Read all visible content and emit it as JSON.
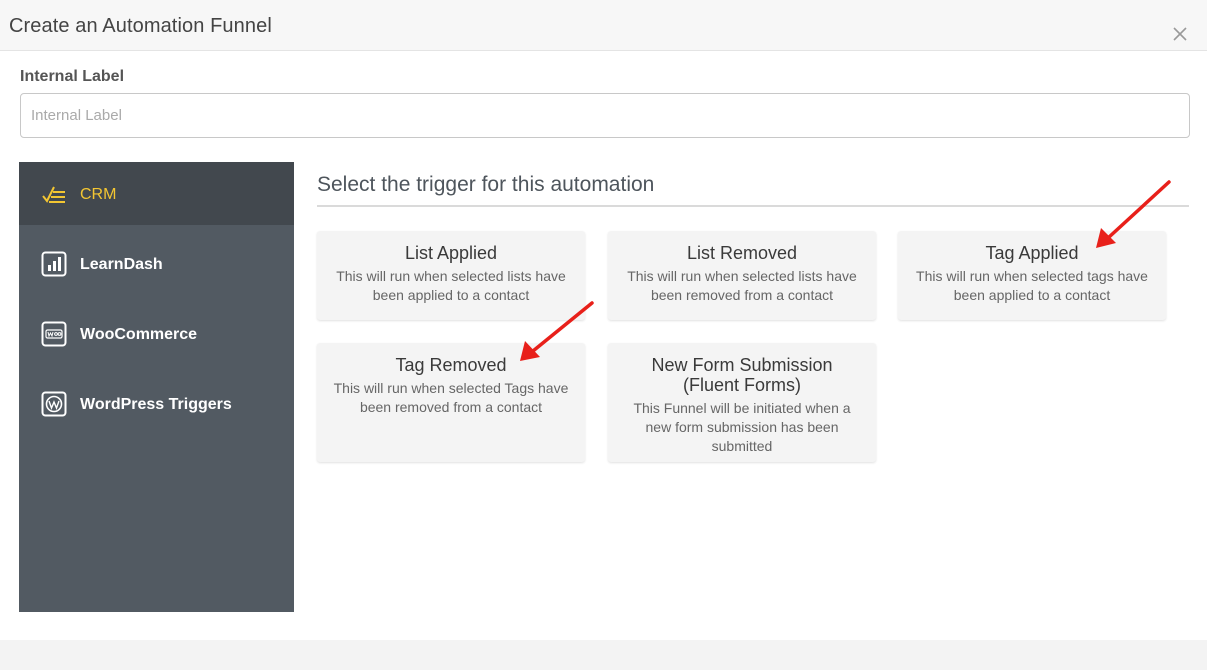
{
  "modal": {
    "title": "Create an Automation Funnel",
    "close_icon": "close-icon"
  },
  "form": {
    "label": "Internal Label",
    "placeholder": "Internal Label",
    "value": ""
  },
  "sidebar": {
    "items": [
      {
        "label": "CRM",
        "icon": "crm-icon",
        "active": true
      },
      {
        "label": "LearnDash",
        "icon": "chart-icon",
        "active": false
      },
      {
        "label": "WooCommerce",
        "icon": "woo-icon",
        "active": false
      },
      {
        "label": "WordPress Triggers",
        "icon": "wordpress-icon",
        "active": false
      }
    ]
  },
  "main": {
    "heading": "Select the trigger for this automation",
    "triggers": [
      {
        "title": "List Applied",
        "description": "This will run when selected lists have been applied to a contact"
      },
      {
        "title": "List Removed",
        "description": "This will run when selected lists have been removed from a contact"
      },
      {
        "title": "Tag Applied",
        "description": "This will run when selected tags have been applied to a contact"
      },
      {
        "title": "Tag Removed",
        "description": "This will run when selected Tags have been removed from a contact"
      },
      {
        "title": "New Form Submission (Fluent Forms)",
        "description": "This Funnel will be initiated when a new form submission has been submitted"
      }
    ]
  },
  "colors": {
    "sidebar_bg": "#525a62",
    "sidebar_active_bg": "#42484e",
    "active_accent": "#f3c632",
    "annotation_arrow": "#e8201a"
  }
}
